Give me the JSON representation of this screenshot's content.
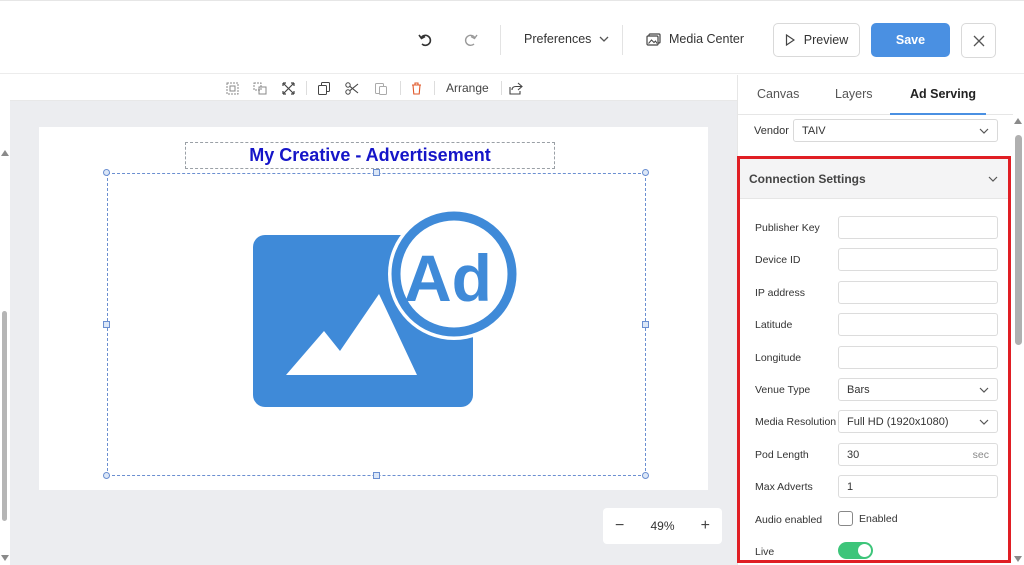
{
  "header": {
    "preferences_label": "Preferences",
    "media_center_label": "Media Center",
    "preview_label": "Preview",
    "save_label": "Save"
  },
  "toolbar": {
    "arrange_label": "Arrange"
  },
  "canvas": {
    "title": "My Creative - Advertisement",
    "ad_text": "Ad"
  },
  "zoom": {
    "minus": "−",
    "value": "49%",
    "plus": "+"
  },
  "panel": {
    "tabs": [
      {
        "label": "Canvas"
      },
      {
        "label": "Layers"
      },
      {
        "label": "Ad Serving",
        "active": true
      }
    ],
    "vendor": {
      "label": "Vendor",
      "value": "TAIV"
    },
    "connection": {
      "title": "Connection Settings",
      "fields": [
        {
          "label": "Publisher Key",
          "value": ""
        },
        {
          "label": "Device ID",
          "value": ""
        },
        {
          "label": "IP address",
          "value": ""
        },
        {
          "label": "Latitude",
          "value": ""
        },
        {
          "label": "Longitude",
          "value": ""
        },
        {
          "label": "Venue Type",
          "value": "Bars"
        },
        {
          "label": "Media Resolution",
          "value": "Full HD (1920x1080)"
        },
        {
          "label": "Pod Length",
          "value": "30",
          "unit": "sec"
        },
        {
          "label": "Max Adverts",
          "value": "1"
        },
        {
          "label": "Audio enabled",
          "checkbox_label": "Enabled",
          "checked": false
        },
        {
          "label": "Live",
          "on": true
        }
      ]
    }
  },
  "colors": {
    "accent": "#4a90e2",
    "highlight_border": "#e01e24",
    "title_text": "#1515c8",
    "ad_icon": "#3f8ad8",
    "toggle_on": "#3dc57a",
    "delete_icon": "#e0582a"
  },
  "icons": [
    "undo-icon",
    "redo-icon",
    "chevron-down-icon",
    "media-center-icon",
    "play-icon",
    "close-icon",
    "trash-icon",
    "scissors-icon",
    "copy-icon",
    "paste-icon",
    "share-icon",
    "ad-image-icon"
  ]
}
